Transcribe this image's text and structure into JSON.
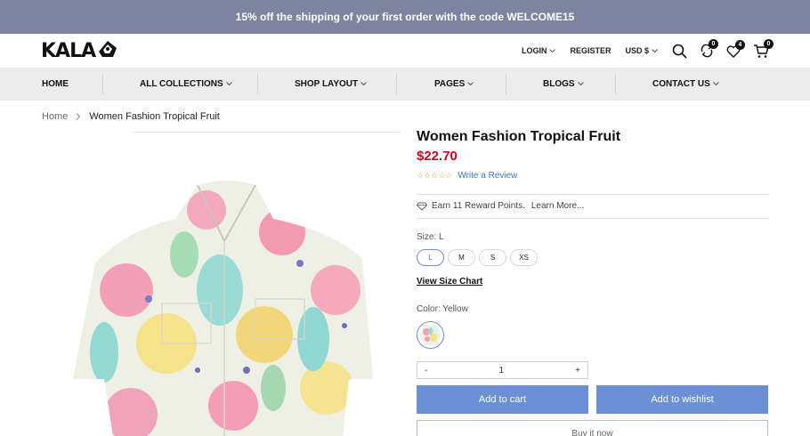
{
  "announcement": {
    "text": "15% off the shipping of your first order with the code WELCOME15",
    "bg": "#7e84a0"
  },
  "header": {
    "logo": "KALA",
    "login": "LOGIN",
    "register": "REGISTER",
    "currency": "USD $",
    "compare_count": "0",
    "wishlist_count": "4",
    "cart_count": "0"
  },
  "nav": {
    "home": "HOME",
    "collections": "ALL COLLECTIONS",
    "shop_layout": "SHOP LAYOUT",
    "pages": "PAGES",
    "blogs": "BLOGS",
    "contact": "CONTACT US"
  },
  "breadcrumb": {
    "home": "Home",
    "current": "Women Fashion Tropical Fruit"
  },
  "product": {
    "title": "Women Fashion Tropical Fruit",
    "price": "$22.70",
    "price_color": "#d0021b",
    "rating_stars": "☆☆☆☆☆",
    "review_link": "Write a Review",
    "reward_text": "Earn 11 Reward Points.",
    "learn_more": "Learn More...",
    "size_label": "Size: L",
    "sizes": [
      "L",
      "M",
      "S",
      "XS"
    ],
    "size_chart": "View Size Chart",
    "color_label": "Color: Yellow",
    "qty_minus": "-",
    "quantity": "1",
    "qty_plus": "+",
    "add_to_cart": "Add to cart",
    "add_to_wishlist": "Add to wishlist",
    "buy_now": "Buy it now",
    "accent": "#6b90d6"
  }
}
